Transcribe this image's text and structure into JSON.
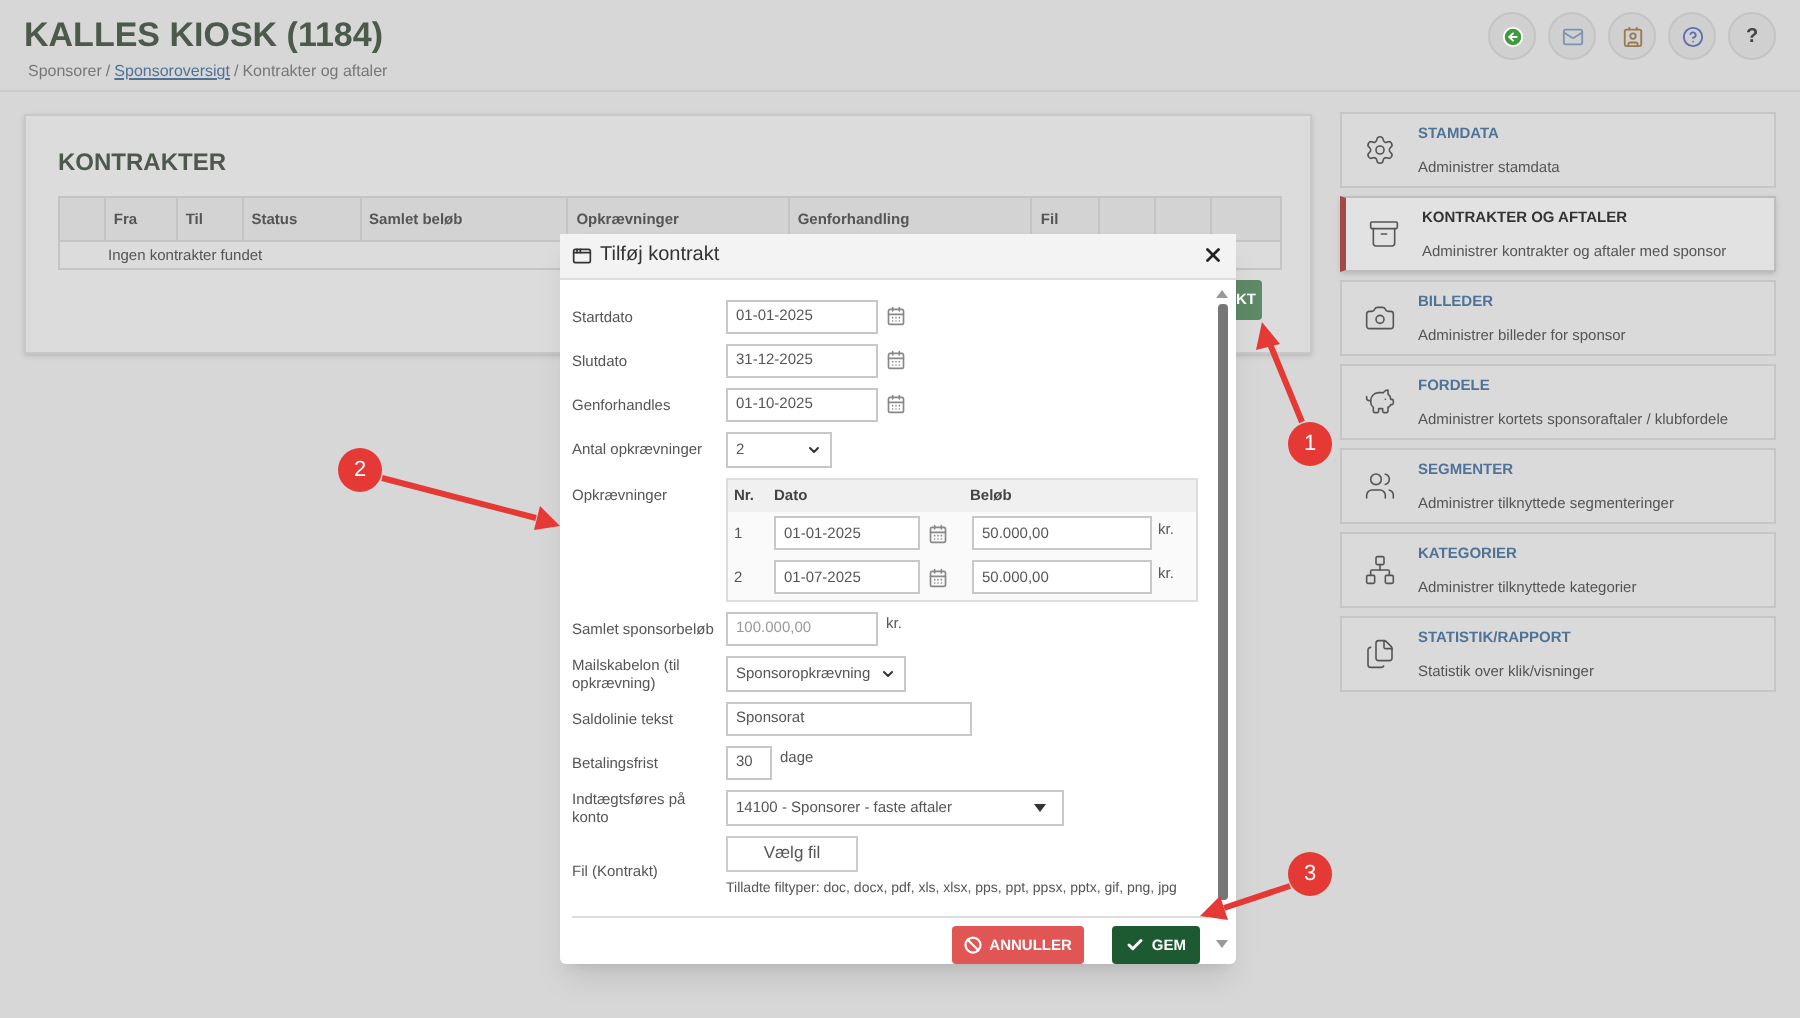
{
  "header": {
    "title": "KALLES KIOSK (1184)",
    "breadcrumb": {
      "separator": "/",
      "items": [
        {
          "label": "Sponsorer",
          "link": false
        },
        {
          "label": "Sponsoroversigt",
          "link": true
        },
        {
          "label": "Kontrakter og aftaler",
          "link": false
        }
      ]
    },
    "toolbar": [
      {
        "kind": "back"
      },
      {
        "kind": "mail"
      },
      {
        "kind": "contacts"
      },
      {
        "kind": "help"
      },
      {
        "kind": "text",
        "label": "?"
      }
    ]
  },
  "contracts": {
    "title": "KONTRAKTER",
    "columns": [
      "Fra",
      "Til",
      "Status",
      "Samlet beløb",
      "Opkrævninger",
      "Genforhandling",
      "Fil"
    ],
    "empty_text": "Ingen kontrakter fundet",
    "add_button": "KT"
  },
  "sidebar": {
    "items": [
      {
        "kind": "gear",
        "title": "STAMDATA",
        "subtitle": "Administrer stamdata",
        "selected": false
      },
      {
        "kind": "box",
        "title": "KONTRAKTER OG AFTALER",
        "subtitle": "Administrer kontrakter og aftaler med sponsor",
        "selected": true
      },
      {
        "kind": "camera",
        "title": "BILLEDER",
        "subtitle": "Administrer billeder for sponsor",
        "selected": false
      },
      {
        "kind": "piggy",
        "title": "FORDELE",
        "subtitle": "Administrer kortets sponsoraftaler / klubfordele",
        "selected": false
      },
      {
        "kind": "people",
        "title": "SEGMENTER",
        "subtitle": "Administrer tilknyttede segmenteringer",
        "selected": false
      },
      {
        "kind": "tree",
        "title": "KATEGORIER",
        "subtitle": "Administrer tilknyttede kategorier",
        "selected": false
      },
      {
        "kind": "docs",
        "title": "STATISTIK/RAPPORT",
        "subtitle": "Statistik over klik/visninger",
        "selected": false
      }
    ]
  },
  "dialog": {
    "title": "Tilføj kontrakt",
    "fields": [
      {
        "kind": "date",
        "label": "Startdato",
        "value": "01-01-2025"
      },
      {
        "kind": "date",
        "label": "Slutdato",
        "value": "31-12-2025"
      },
      {
        "kind": "date",
        "label": "Genforhandles",
        "value": "01-10-2025"
      },
      {
        "kind": "count",
        "label": "Antal opkrævninger",
        "value": "2"
      },
      {
        "kind": "charges",
        "label": "Opkrævninger",
        "columns": [
          "Nr.",
          "Dato",
          "Beløb"
        ],
        "rows": [
          {
            "nr": "1",
            "date": "01-01-2025",
            "amount": "50.000,00",
            "unit": "kr."
          },
          {
            "nr": "2",
            "date": "01-07-2025",
            "amount": "50.000,00",
            "unit": "kr."
          }
        ]
      },
      {
        "kind": "amount",
        "label": "Samlet sponsorbeløb",
        "value": "100.000,00",
        "unit": "kr.",
        "disabled": true
      },
      {
        "kind": "select",
        "label": "Mailskabelon (til opkrævning)",
        "value": "Sponsoropkrævning"
      },
      {
        "kind": "text",
        "label": "Saldolinie tekst",
        "value": "Sponsorat"
      },
      {
        "kind": "days",
        "label": "Betalingsfrist",
        "value": "30",
        "unit": "dage"
      },
      {
        "kind": "combo",
        "label": "Indtægtsføres på konto",
        "value": "14100 - Sponsorer - faste aftaler"
      },
      {
        "kind": "file",
        "label": "Fil (Kontrakt)",
        "button": "Vælg fil",
        "hint": "Tilladte filtyper: doc, docx, pdf, xls, xlsx, pps, ppt, ppsx, pptx, gif, png, jpg"
      }
    ],
    "cancel": "ANNULLER",
    "save": "GEM"
  },
  "annotations": [
    {
      "label": "1"
    },
    {
      "label": "2"
    },
    {
      "label": "3"
    }
  ]
}
